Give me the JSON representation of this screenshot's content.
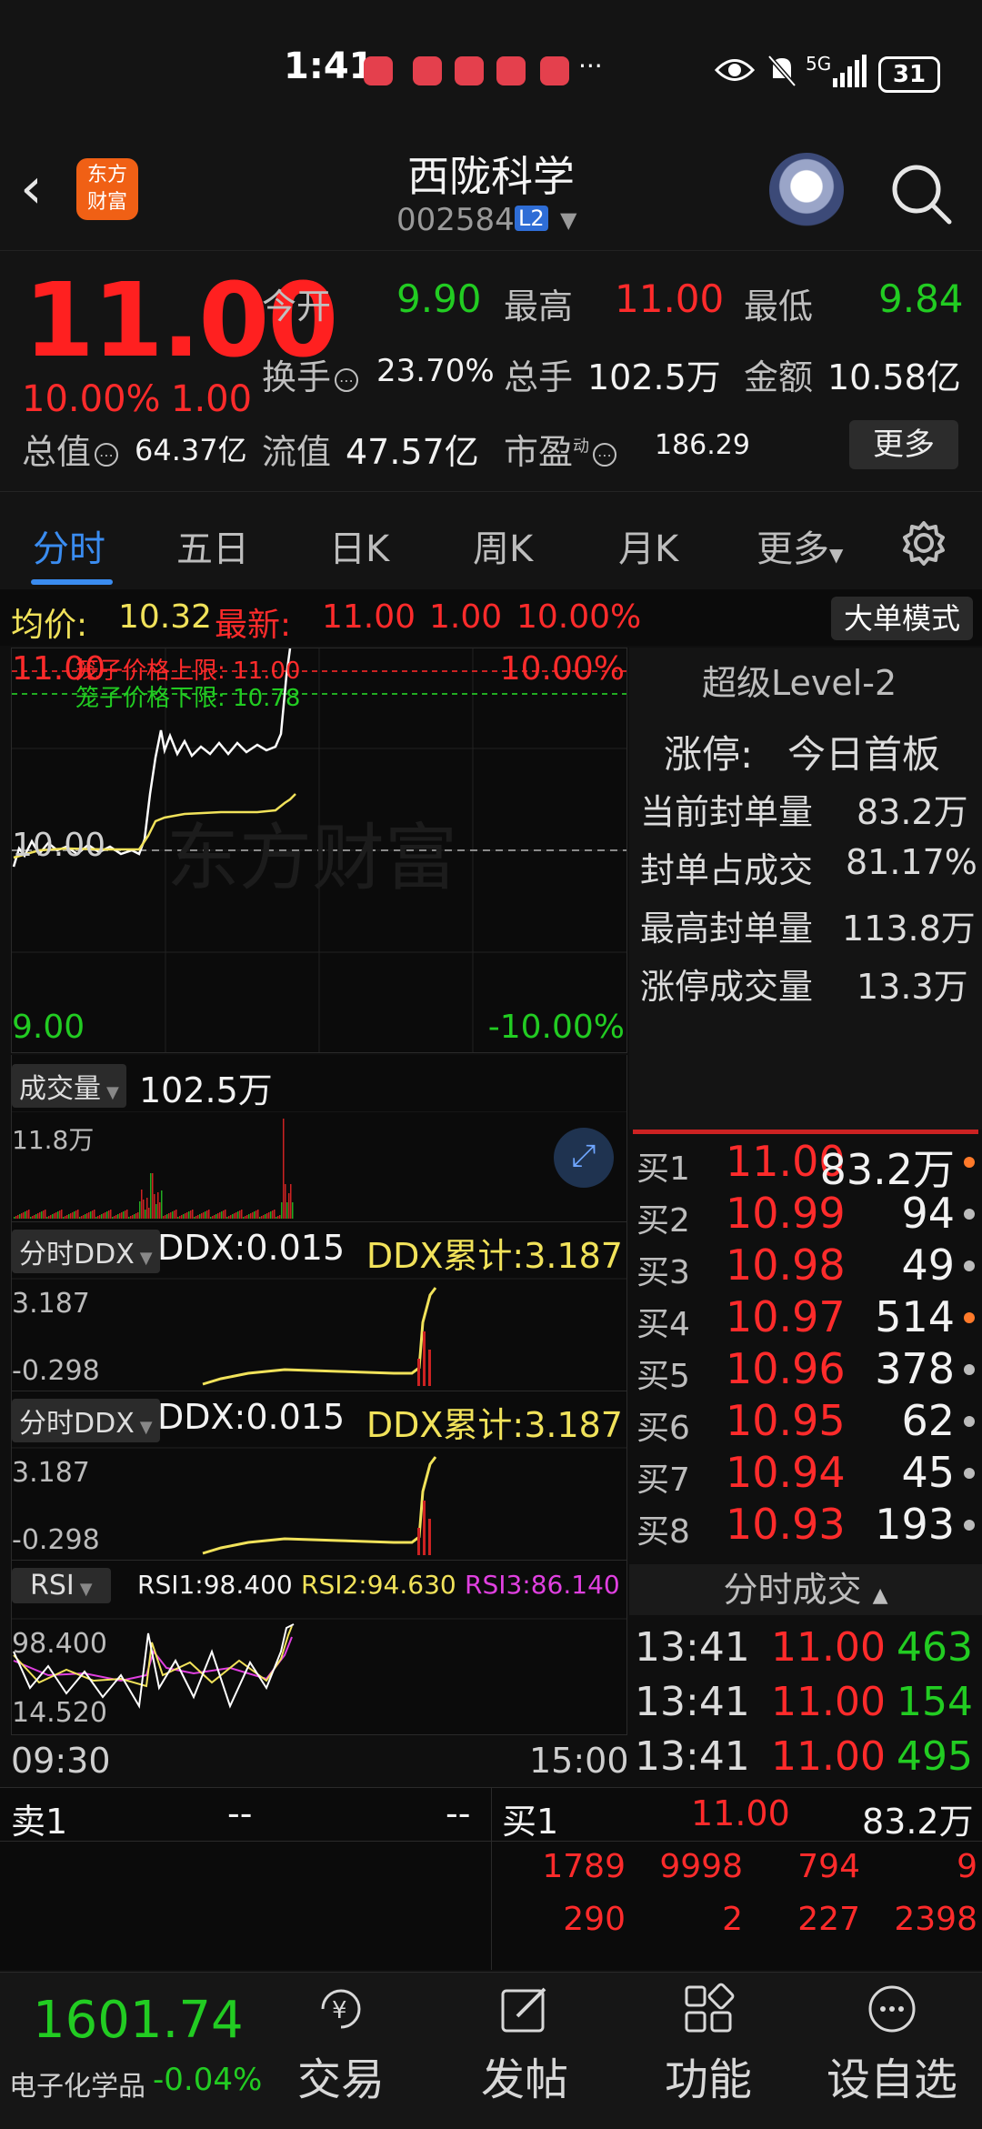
{
  "status": {
    "time": "1:41",
    "network": "5G",
    "battery": "31"
  },
  "header": {
    "title": "西陇科学",
    "code": "002584",
    "level": "L2",
    "logo_line1": "东方",
    "logo_line2": "财富"
  },
  "quote": {
    "price": "11.00",
    "pct": "10.00%",
    "chg": "1.00",
    "open_label": "今开",
    "open": "9.90",
    "high_label": "最高",
    "high": "11.00",
    "low_label": "最低",
    "low": "9.84",
    "turnover_label": "换手",
    "turnover": "23.70%",
    "volume_label": "总手",
    "volume": "102.5万",
    "amount_label": "金额",
    "amount": "10.58亿",
    "mktcap_label": "总值",
    "mktcap": "64.37亿",
    "float_label": "流值",
    "float": "47.57亿",
    "pe_label": "市盈",
    "pe_sup": "动",
    "pe": "186.29",
    "more": "更多"
  },
  "tabs": [
    "分时",
    "五日",
    "日K",
    "周K",
    "月K",
    "更多"
  ],
  "avg": {
    "label": "均价:",
    "value": "10.32",
    "latest_label": "最新:",
    "latest": "11.00",
    "chg": "1.00",
    "pct": "10.00%",
    "big_order": "大单模式"
  },
  "intraday": {
    "top_price": "11.00",
    "top_pct": "10.00%",
    "bottom_price": "9.00",
    "bottom_pct": "-10.00%",
    "mid_price": "10.00",
    "upper_limit": "笼子价格上限: 11.00",
    "lower_limit": "笼子价格下限: 10.78",
    "watermark": "东方财富"
  },
  "volume": {
    "selector": "成交量",
    "total": "102.5万",
    "max": "11.8万"
  },
  "ddx1": {
    "selector": "分时DDX",
    "ddx": "DDX:0.015",
    "cum": "DDX累计:3.187",
    "top": "3.187",
    "bottom": "-0.298"
  },
  "ddx2": {
    "selector": "分时DDX",
    "ddx": "DDX:0.015",
    "cum": "DDX累计:3.187",
    "top": "3.187",
    "bottom": "-0.298"
  },
  "rsi": {
    "selector": "RSI",
    "rsi1": "RSI1:98.400",
    "rsi2": "RSI2:94.630",
    "rsi3": "RSI3:86.140",
    "top": "98.400",
    "bottom": "14.520"
  },
  "time_axis": {
    "start": "09:30",
    "end": "15:00"
  },
  "level2": {
    "title": "超级Level-2",
    "limit_label": "涨停:",
    "limit_value": "今日首板",
    "rows": [
      {
        "label": "当前封单量",
        "value": "83.2万"
      },
      {
        "label": "封单占成交",
        "value": "81.17%"
      },
      {
        "label": "最高封单量",
        "value": "113.8万"
      },
      {
        "label": "涨停成交量",
        "value": "13.3万"
      }
    ]
  },
  "book": [
    {
      "label": "买1",
      "price": "11.00",
      "vol": "83.2万"
    },
    {
      "label": "买2",
      "price": "10.99",
      "vol": "94"
    },
    {
      "label": "买3",
      "price": "10.98",
      "vol": "49"
    },
    {
      "label": "买4",
      "price": "10.97",
      "vol": "514"
    },
    {
      "label": "买5",
      "price": "10.96",
      "vol": "378"
    },
    {
      "label": "买6",
      "price": "10.95",
      "vol": "62"
    },
    {
      "label": "买7",
      "price": "10.94",
      "vol": "45"
    },
    {
      "label": "买8",
      "price": "10.93",
      "vol": "193"
    }
  ],
  "ticks_title": "分时成交",
  "ticks": [
    {
      "time": "13:41",
      "price": "11.00",
      "vol": "463"
    },
    {
      "time": "13:41",
      "price": "11.00",
      "vol": "154"
    },
    {
      "time": "13:41",
      "price": "11.00",
      "vol": "495"
    }
  ],
  "queue": {
    "sell_label": "卖1",
    "sell_price": "--",
    "sell_vol": "--",
    "buy_label": "买1",
    "buy_price": "11.00",
    "buy_vol": "83.2万",
    "rows": [
      [
        "1789",
        "9998",
        "794",
        "9"
      ],
      [
        "290",
        "2",
        "227",
        "2398"
      ]
    ]
  },
  "nav": {
    "index_value": "1601.74",
    "index_name": "电子化学品",
    "index_pct": "-0.04%",
    "trade": "交易",
    "post": "发帖",
    "func": "功能",
    "watch": "设自选"
  }
}
